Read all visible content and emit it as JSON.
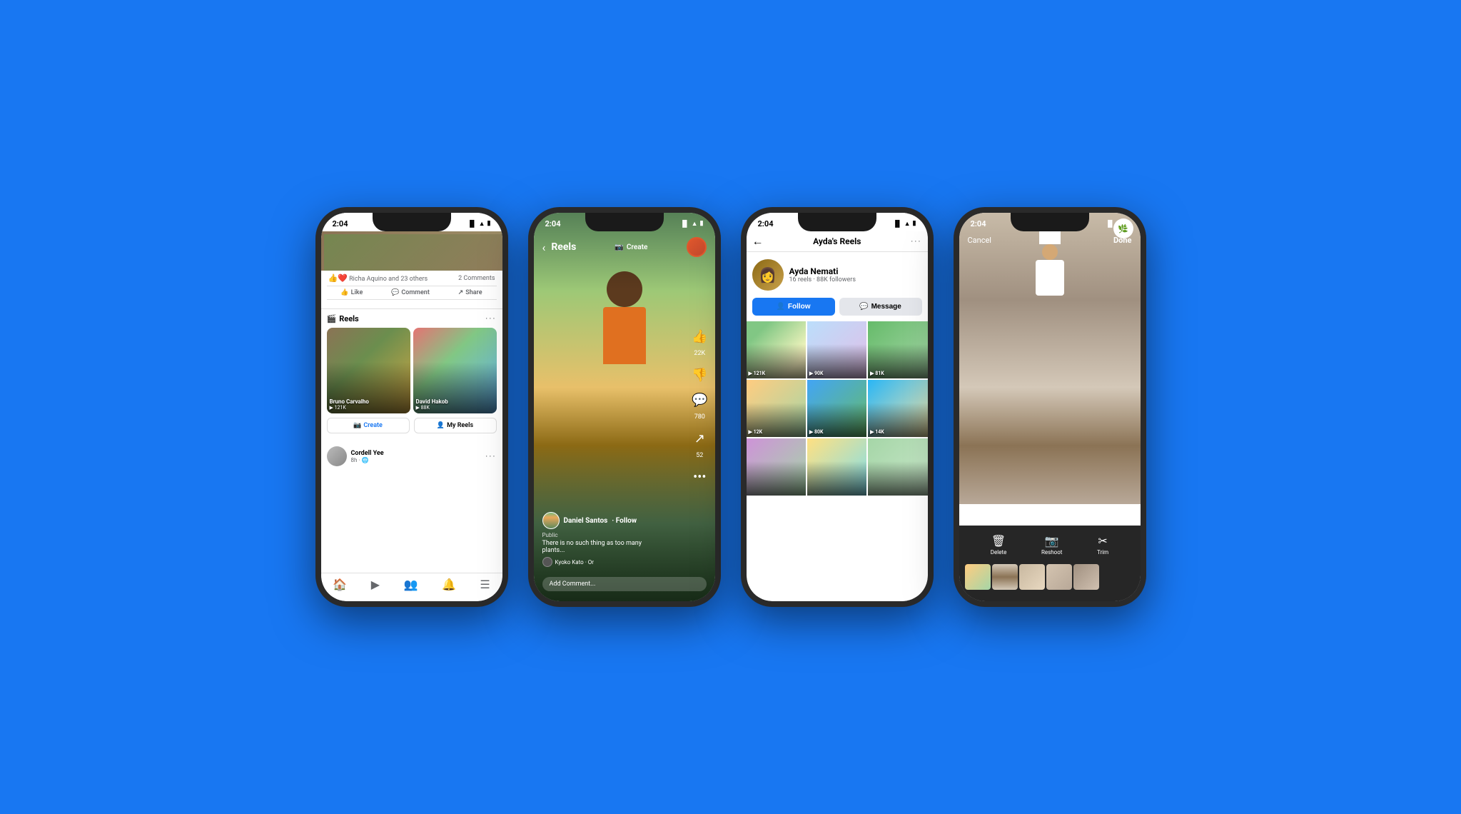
{
  "background_color": "#1877F2",
  "phones": [
    {
      "id": "phone1",
      "label": "Facebook Feed",
      "status_time": "2:04",
      "reactions": "Richa Aquino and 23 others",
      "comments_count": "2 Comments",
      "action_like": "Like",
      "action_comment": "Comment",
      "action_share": "Share",
      "reels_section_title": "Reels",
      "reel1_name": "Bruno Carvalho",
      "reel1_views": "▶ 121K",
      "reel2_name": "David Hakob",
      "reel2_views": "▶ 88K",
      "create_btn": "Create",
      "my_reels_btn": "My Reels",
      "post_user": "Cordell Yee",
      "post_time": "8h · 🌐"
    },
    {
      "id": "phone2",
      "label": "Reels Full Screen",
      "status_time": "2:04",
      "back_label": "Reels",
      "create_label": "Create",
      "username": "Daniel Santos",
      "follow_label": "· Follow",
      "visibility": "Public",
      "caption": "There is no such thing as too many plants...",
      "likes": "22K",
      "comments": "780",
      "shares": "52",
      "music": "Kyoko Kato · Or",
      "comment_placeholder": "Add Comment..."
    },
    {
      "id": "phone3",
      "label": "Ayda's Reels",
      "status_time": "2:04",
      "title": "Ayda's Reels",
      "profile_name": "Ayda Nemati",
      "profile_stats": "16 reels · 88K followers",
      "follow_btn": "Follow",
      "message_btn": "Message",
      "reels": [
        {
          "count": "▶ 121K"
        },
        {
          "count": "▶ 90K"
        },
        {
          "count": "▶ 81K"
        },
        {
          "count": "▶ 12K"
        },
        {
          "count": "▶ 80K"
        },
        {
          "count": "▶ 14K"
        },
        {
          "count": ""
        },
        {
          "count": ""
        },
        {
          "count": ""
        }
      ]
    },
    {
      "id": "phone4",
      "label": "Video Editor",
      "status_time": "2:04",
      "cancel_btn": "Cancel",
      "done_btn": "Done",
      "delete_label": "Delete",
      "reshoot_label": "Reshoot",
      "trim_label": "Trim"
    }
  ]
}
